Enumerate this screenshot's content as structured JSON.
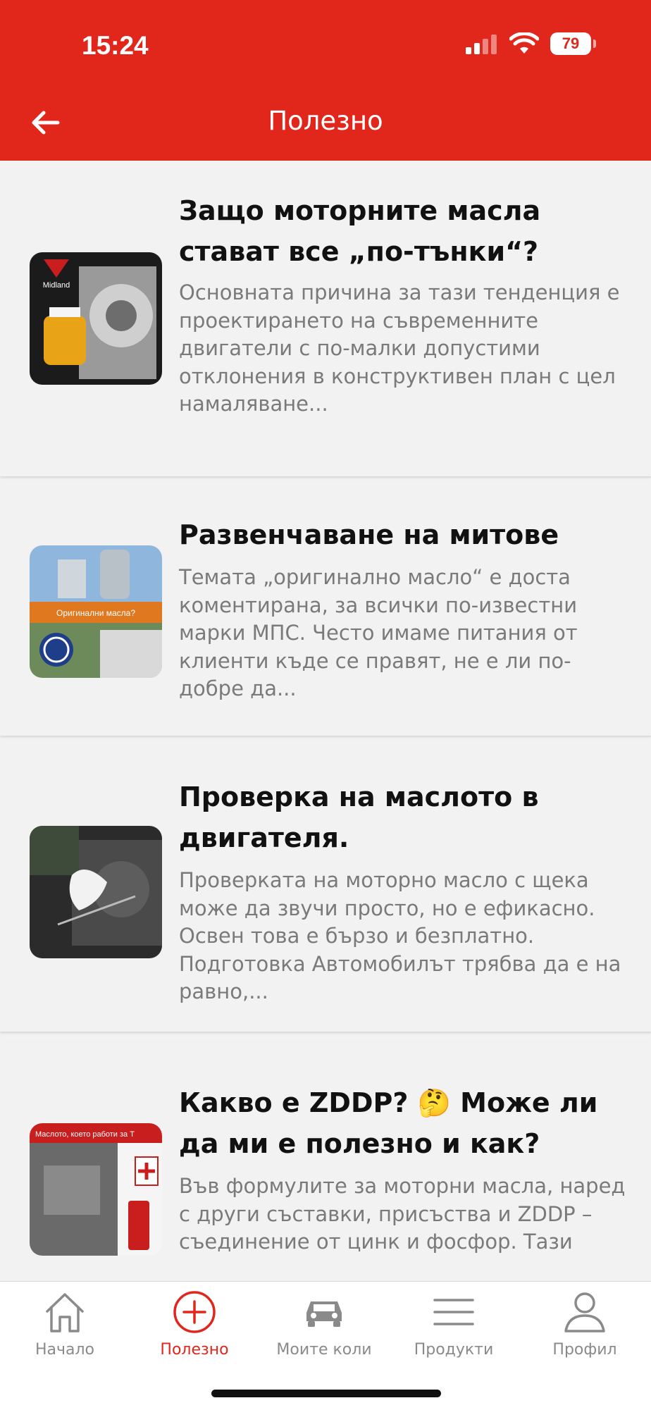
{
  "status_bar": {
    "time": "15:24",
    "battery": "79"
  },
  "header": {
    "title": "Полезно"
  },
  "articles": [
    {
      "title": "Защо моторните масла стават все „по-тънки“?",
      "excerpt": "Основната причина за тази тенденция е проектирането на съвременните двигатели с по-малки допустими отклонения в конструктивен план с цел намаляване...",
      "image_label": "Midland"
    },
    {
      "title": "Развенчаване на митове",
      "excerpt": "Темата  „оригинално масло“ е доста коментирана, за всички по-известни марки МПС. Често имаме питания от клиенти къде се правят, не е ли по-добре да...",
      "image_label": "Оригинални масла?"
    },
    {
      "title": "Проверка на маслото в двигателя.",
      "excerpt": "Проверката на моторно масло с щека може да звучи просто, но е ефикасно. Освен това е бързо и безплатно. Подготовка Автомобилът трябва да е на равно,...",
      "image_label": ""
    },
    {
      "title": "Какво е ZDDP? 🤔 Може ли да ми е полезно и как?",
      "excerpt": "Във формулите за моторни масла, наред с други съставки, присъства и ZDDP – съединение от цинк и фосфор. Тази присадка има",
      "image_label": "Маслото, което работи за Т"
    }
  ],
  "tabbar": {
    "items": [
      {
        "label": "Начало",
        "icon": "home-icon",
        "active": false
      },
      {
        "label": "Полезно",
        "icon": "plus-circle-icon",
        "active": true
      },
      {
        "label": "Моите коли",
        "icon": "car-icon",
        "active": false
      },
      {
        "label": "Продукти",
        "icon": "menu-icon",
        "active": false
      },
      {
        "label": "Профил",
        "icon": "profile-icon",
        "active": false
      }
    ]
  },
  "colors": {
    "brand": "#e1261c",
    "background": "#f2f2f2",
    "excerpt": "#7a7a7a",
    "tab_inactive": "#8a8a8a"
  }
}
